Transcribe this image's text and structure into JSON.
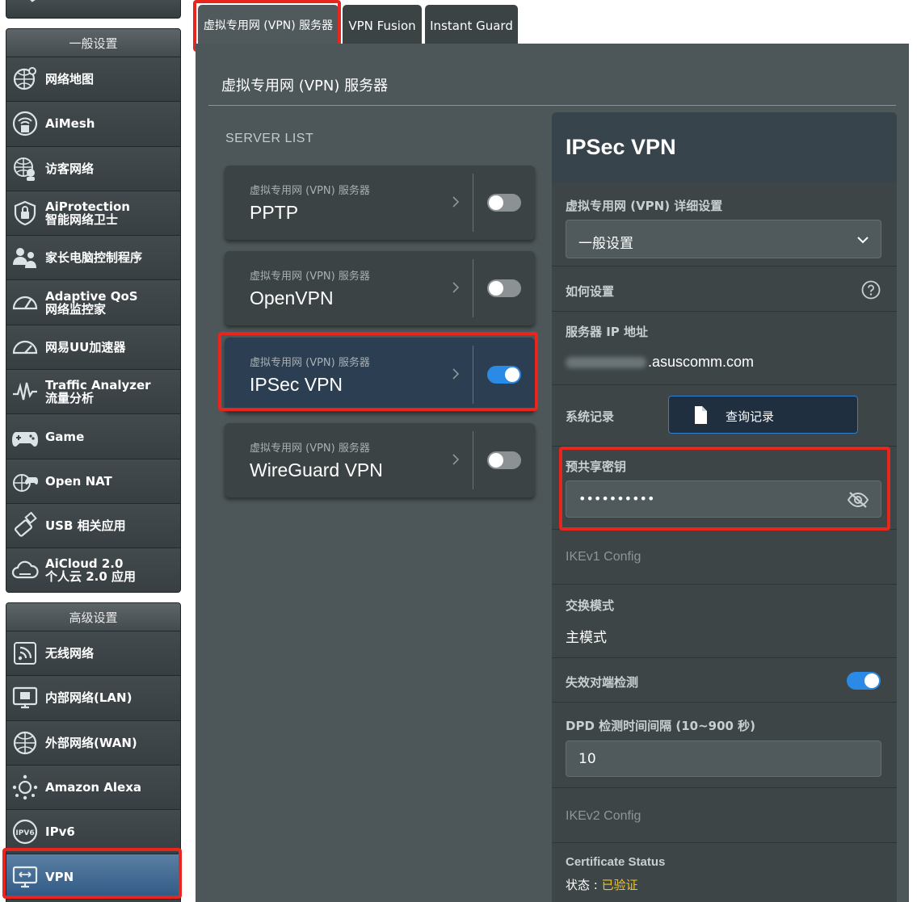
{
  "sidebar": {
    "general_header": "一般设置",
    "general_items": [
      {
        "label": "网络地图",
        "icon": "network-map-icon"
      },
      {
        "label": "AiMesh",
        "icon": "aimesh-icon"
      },
      {
        "label": "访客网络",
        "icon": "guest-network-icon"
      },
      {
        "label": "AiProtection",
        "label2": "智能网络卫士",
        "icon": "aiprotection-icon"
      },
      {
        "label": "家长电脑控制程序",
        "icon": "parental-control-icon"
      },
      {
        "label": "Adaptive QoS",
        "label2": "网络监控家",
        "icon": "qos-gauge-icon"
      },
      {
        "label": "网易UU加速器",
        "icon": "uu-accelerator-icon"
      },
      {
        "label": "Traffic Analyzer",
        "label2": "流量分析",
        "icon": "traffic-analyzer-icon"
      },
      {
        "label": "Game",
        "icon": "gamepad-icon"
      },
      {
        "label": "Open NAT",
        "icon": "open-nat-icon"
      },
      {
        "label": "USB 相关应用",
        "icon": "usb-icon"
      },
      {
        "label": "AiCloud 2.0",
        "label2": "个人云 2.0 应用",
        "icon": "aicloud-icon"
      }
    ],
    "advanced_header": "高级设置",
    "advanced_items": [
      {
        "label": "无线网络",
        "icon": "wireless-icon"
      },
      {
        "label": "内部网络(LAN)",
        "icon": "lan-icon"
      },
      {
        "label": "外部网络(WAN)",
        "icon": "wan-globe-icon"
      },
      {
        "label": "Amazon Alexa",
        "icon": "alexa-icon"
      },
      {
        "label": "IPv6",
        "icon": "ipv6-icon"
      },
      {
        "label": "VPN",
        "icon": "vpn-monitor-icon",
        "active": true
      }
    ]
  },
  "tabs": [
    {
      "label": "虚拟专用网 (VPN) 服务器",
      "active": true
    },
    {
      "label": "VPN Fusion"
    },
    {
      "label": "Instant Guard"
    }
  ],
  "main": {
    "title": "虚拟专用网 (VPN) 服务器",
    "server_list_label": "SERVER LIST",
    "servers": [
      {
        "subtitle": "虚拟专用网 (VPN) 服务器",
        "name": "PPTP",
        "enabled": false
      },
      {
        "subtitle": "虚拟专用网 (VPN) 服务器",
        "name": "OpenVPN",
        "enabled": false
      },
      {
        "subtitle": "虚拟专用网 (VPN) 服务器",
        "name": "IPSec VPN",
        "enabled": true,
        "selected": true
      },
      {
        "subtitle": "虚拟专用网 (VPN) 服务器",
        "name": "WireGuard VPN",
        "enabled": false
      }
    ]
  },
  "detail": {
    "title": "IPSec VPN",
    "detail_settings_label": "虚拟专用网 (VPN) 详细设置",
    "detail_settings_value": "一般设置",
    "how_to_label": "如何设置",
    "server_ip_label": "服务器 IP 地址",
    "server_ip_suffix": ".asuscomm.com",
    "syslog_label": "系统记录",
    "syslog_button": "查询记录",
    "psk_label": "预共享密钥",
    "psk_value": "••••••••••",
    "ikev1_label": "IKEv1 Config",
    "exchange_mode_label": "交换模式",
    "exchange_mode_value": "主模式",
    "dpd_label": "失效对端检测",
    "dpd_enabled": true,
    "dpd_interval_label": "DPD 检测时间间隔 (10~900 秒)",
    "dpd_interval_value": "10",
    "ikev2_label": "IKEv2 Config",
    "cert_status_label": "Certificate Status",
    "status_prefix": "状态 : ",
    "status_value": "已验证"
  },
  "colors": {
    "highlight": "#e8261e",
    "toggle_on": "#2b8ae6",
    "status_ok": "#f2c31b"
  }
}
